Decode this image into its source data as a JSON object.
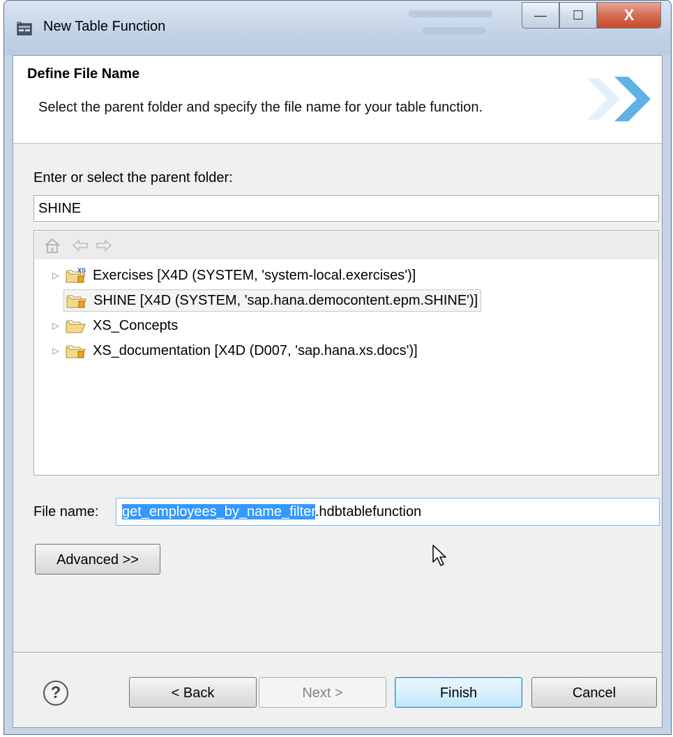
{
  "window": {
    "title": "New Table Function",
    "caption_buttons": {
      "minimize": "—",
      "maximize": "☐",
      "close": "X"
    }
  },
  "header": {
    "title": "Define File Name",
    "description": "Select the parent folder and specify the file name for your table function."
  },
  "parent_folder": {
    "label": "Enter or select the parent folder:",
    "value": "SHINE"
  },
  "tree": {
    "toolbar_icons": [
      "home-icon",
      "back-arrow-icon",
      "forward-arrow-icon"
    ],
    "items": [
      {
        "label": "Exercises [X4D (SYSTEM, 'system-local.exercises')]",
        "expandable": true,
        "selected": false,
        "icon": "xs-project-folder-icon"
      },
      {
        "label": "SHINE [X4D (SYSTEM, 'sap.hana.democontent.epm.SHINE')]",
        "expandable": false,
        "selected": true,
        "icon": "project-folder-icon"
      },
      {
        "label": "XS_Concepts",
        "expandable": true,
        "selected": false,
        "icon": "folder-icon"
      },
      {
        "label": "XS_documentation [X4D (D007, 'sap.hana.xs.docs')]",
        "expandable": true,
        "selected": false,
        "icon": "project-folder-icon"
      }
    ]
  },
  "file_name": {
    "label": "File name:",
    "selected_part": "get_employees_by_name_filter",
    "extension": ".hdbtablefunction"
  },
  "advanced_button": "Advanced >>",
  "footer": {
    "help": "?",
    "back": "< Back",
    "next": "Next >",
    "finish": "Finish",
    "cancel": "Cancel"
  }
}
